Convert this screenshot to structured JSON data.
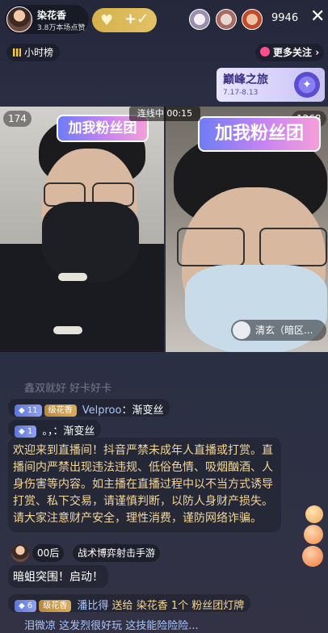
{
  "header": {
    "host_name": "染花香",
    "host_likes": "3.8万本场点赞",
    "follow_heart": "♥",
    "follow_plus": "+✓",
    "viewer_count": "9946",
    "close": "✕"
  },
  "subbar": {
    "rank_label": "小时榜",
    "more_follow_label": "更多关注",
    "chevron": "›"
  },
  "event": {
    "title": "巅峰之旅",
    "dates": "7.17-8.13"
  },
  "pk": {
    "status": "连线中",
    "timer": "00:15",
    "left_count": "174",
    "right_count": "1268",
    "fan_banner": "加我粉丝团",
    "guest_name": "清玄（暗区..."
  },
  "chat": {
    "faded_line": "鑫双就好    好卡好卡",
    "line1": {
      "badge": "11",
      "level": "级花香",
      "user": "Velproo",
      "text": "：渐变丝"
    },
    "line2": {
      "badge": "1",
      "text": "。，：渐变丝"
    },
    "announcement": "欢迎来到直播间！抖音严禁未成年人直播或打赏。直播间内严禁出现违法违规、低俗色情、吸烟酗酒、人身伤害等内容。如主播在直播过程中以不当方式诱导打赏、私下交易，请谨慎判断，以防人身财产损失。请大家注意财产安全，理性消费，谨防网络诈骗。",
    "gift_row": {
      "tag1": "00后",
      "tag2": "战术博弈射击手游",
      "text": "暗蛆突围！启动！"
    },
    "bottom_line": {
      "badge": "6",
      "level": "级花香",
      "user": "潘比得",
      "action": "送给",
      "target": "染花香",
      "gift": "1个",
      "item": "粉丝团灯牌"
    },
    "cut_line": "泪微凉    这发烈很好玩  这技能险险险..."
  }
}
